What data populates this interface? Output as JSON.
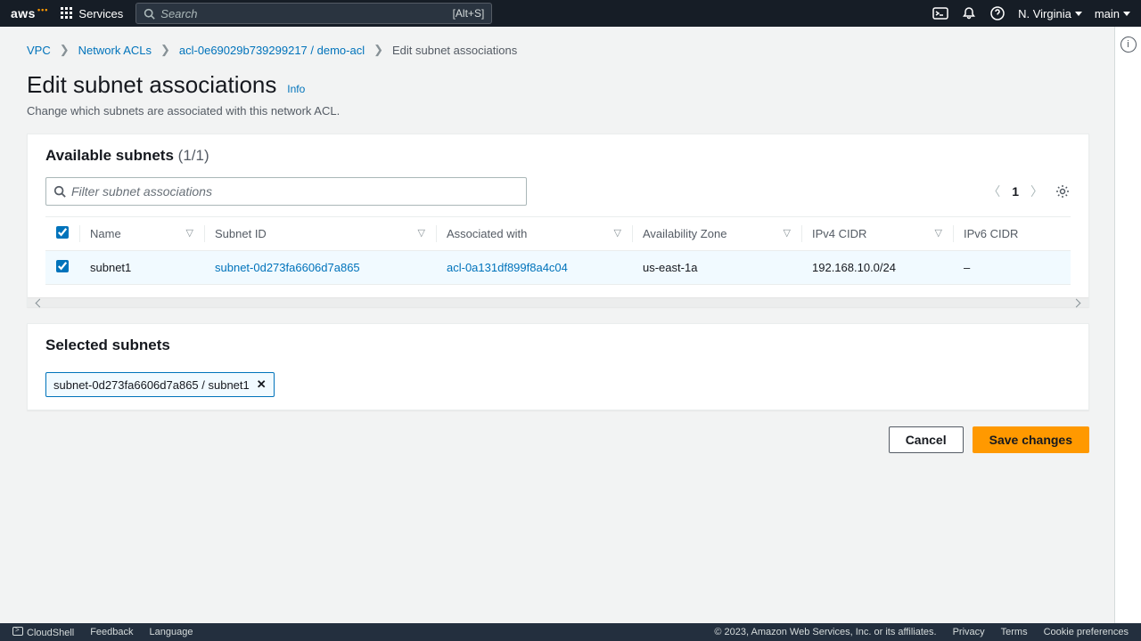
{
  "nav": {
    "logo": "aws",
    "services": "Services",
    "search_placeholder": "Search",
    "search_shortcut": "[Alt+S]",
    "region": "N. Virginia",
    "account": "main"
  },
  "breadcrumbs": {
    "vpc": "VPC",
    "nacls": "Network ACLs",
    "acl": "acl-0e69029b739299217 / demo-acl",
    "current": "Edit subnet associations"
  },
  "page": {
    "title": "Edit subnet associations",
    "info": "Info",
    "subtitle": "Change which subnets are associated with this network ACL."
  },
  "available": {
    "heading": "Available subnets",
    "count": "(1/1)",
    "filter_placeholder": "Filter subnet associations",
    "page_num": "1",
    "columns": {
      "name": "Name",
      "subnet_id": "Subnet ID",
      "associated_with": "Associated with",
      "az": "Availability Zone",
      "ipv4": "IPv4 CIDR",
      "ipv6": "IPv6 CIDR"
    },
    "rows": [
      {
        "name": "subnet1",
        "subnet_id": "subnet-0d273fa6606d7a865",
        "associated_with": "acl-0a131df899f8a4c04",
        "az": "us-east-1a",
        "ipv4": "192.168.10.0/24",
        "ipv6": "–"
      }
    ]
  },
  "selected": {
    "heading": "Selected subnets",
    "token": "subnet-0d273fa6606d7a865 / subnet1"
  },
  "actions": {
    "cancel": "Cancel",
    "save": "Save changes"
  },
  "footer": {
    "cloudshell": "CloudShell",
    "feedback": "Feedback",
    "language": "Language",
    "copyright": "© 2023, Amazon Web Services, Inc. or its affiliates.",
    "privacy": "Privacy",
    "terms": "Terms",
    "cookies": "Cookie preferences"
  }
}
